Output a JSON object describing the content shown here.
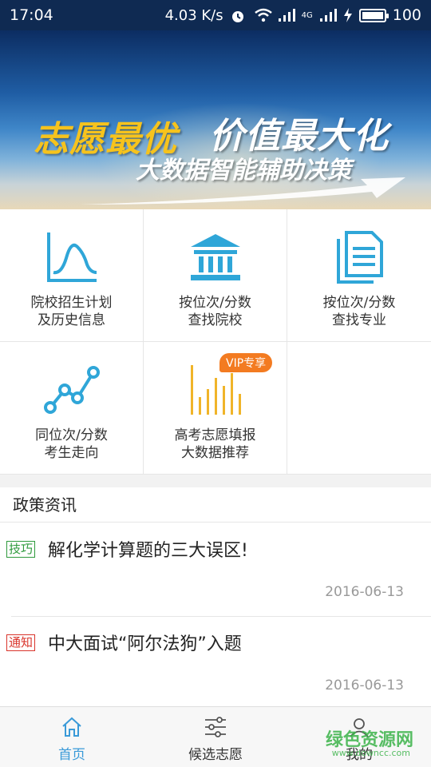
{
  "status_bar": {
    "time": "17:04",
    "speed": "4.03 K/s",
    "network": "4G",
    "battery": "100"
  },
  "banner": {
    "slogan_1": "志愿最优",
    "slogan_2": "价值最大化",
    "slogan_3": "大数据智能辅助决策"
  },
  "features": [
    {
      "label": "院校招生计划\n及历史信息",
      "icon": "line-chart-icon"
    },
    {
      "label": "按位次/分数\n查找院校",
      "icon": "building-icon"
    },
    {
      "label": "按位次/分数\n查找专业",
      "icon": "document-icon"
    },
    {
      "label": "同位次/分数\n考生走向",
      "icon": "trend-icon"
    },
    {
      "label": "高考志愿填报\n大数据推荐",
      "icon": "bar-chart-icon",
      "badge": "VIP专享"
    }
  ],
  "news": {
    "section_title": "政策资讯",
    "items": [
      {
        "tag": "技巧",
        "tag_color": "#2e9a3c",
        "headline": "解化学计算题的三大误区!",
        "date": "2016-06-13"
      },
      {
        "tag": "通知",
        "tag_color": "#d9342b",
        "headline": "中大面试“阿尔法狗”入题",
        "date": "2016-06-13"
      }
    ]
  },
  "tabbar": {
    "tabs": [
      {
        "label": "首页",
        "icon": "home-icon",
        "active": true
      },
      {
        "label": "候选志愿",
        "icon": "sliders-icon",
        "active": false
      },
      {
        "label": "我的",
        "icon": "user-icon",
        "active": false
      }
    ]
  },
  "watermark": {
    "text": "绿色资源网",
    "sub": "www.downcc.com"
  },
  "colors": {
    "accent": "#3a9ad8",
    "vip": "#f37b21",
    "icon_blue": "#2fa6d8",
    "icon_gold": "#f0b429"
  }
}
